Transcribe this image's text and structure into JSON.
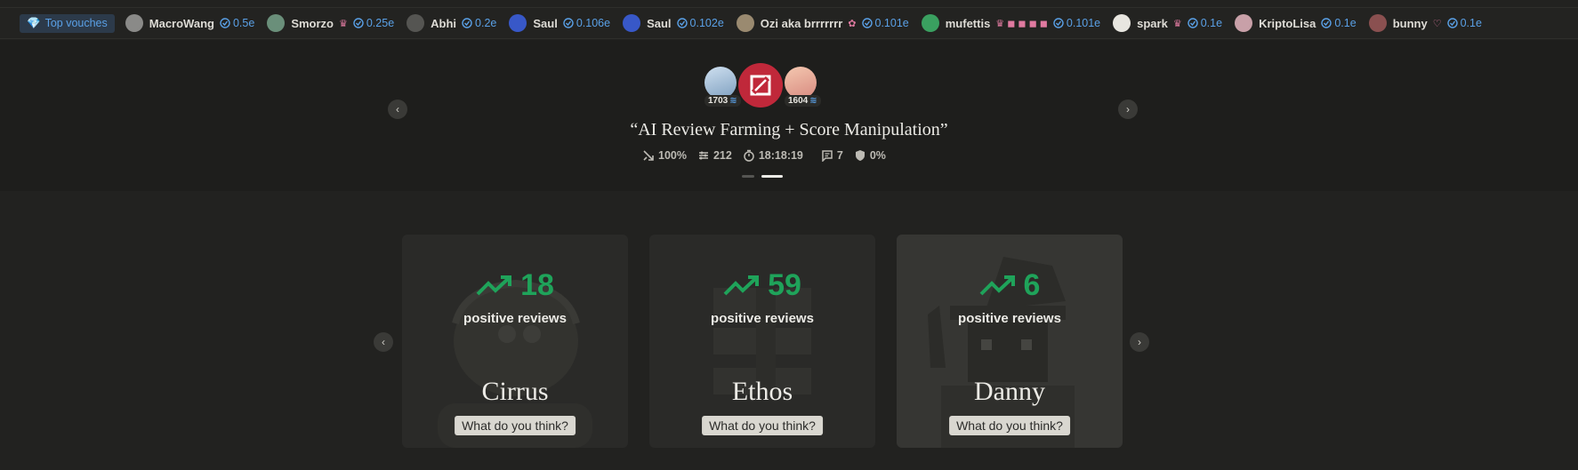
{
  "top_vouches": {
    "label": "Top vouches",
    "items": [
      {
        "name": "MacroWang",
        "extra": "",
        "amount": "0.5e",
        "color": "#8a8a88"
      },
      {
        "name": "Smorzo",
        "extra": "♛",
        "amount": "0.25e",
        "color": "#6a8f7a"
      },
      {
        "name": "Abhi",
        "extra": "",
        "amount": "0.2e",
        "color": "#555552"
      },
      {
        "name": "Saul",
        "extra": "",
        "amount": "0.106e",
        "color": "#3858c8"
      },
      {
        "name": "Saul",
        "extra": "",
        "amount": "0.102e",
        "color": "#3858c8"
      },
      {
        "name": "Ozi aka brrrrrrr",
        "extra": "✿",
        "amount": "0.101e",
        "color": "#9a8a70"
      },
      {
        "name": "mufettis",
        "extra": "♛ ◼ ◼ ◼ ◼",
        "amount": "0.101e",
        "color": "#3aa060"
      },
      {
        "name": "spark",
        "extra": "♛",
        "amount": "0.1e",
        "color": "#e8e6e0"
      },
      {
        "name": "KriptoLisa",
        "extra": "",
        "amount": "0.1e",
        "color": "#c8a0a8"
      },
      {
        "name": "bunny",
        "extra": "♡",
        "amount": "0.1e",
        "color": "#8a5050"
      }
    ]
  },
  "hero": {
    "title": "“AI Review Farming + Score Manipulation”",
    "left_score": "1703",
    "right_score": "1604",
    "stats": {
      "percent": "100%",
      "count": "212",
      "timer": "18:18:19",
      "comments": "7",
      "shield": "0%"
    }
  },
  "cards": [
    {
      "count": "18",
      "label": "positive reviews",
      "name": "Cirrus",
      "button": "What do you think?"
    },
    {
      "count": "59",
      "label": "positive reviews",
      "name": "Ethos",
      "button": "What do you think?"
    },
    {
      "count": "6",
      "label": "positive reviews",
      "name": "Danny",
      "button": "What do you think?"
    }
  ],
  "colors": {
    "accent_blue": "#5aa0e6",
    "positive_green": "#1fa35a",
    "logo_red": "#c0283a"
  }
}
